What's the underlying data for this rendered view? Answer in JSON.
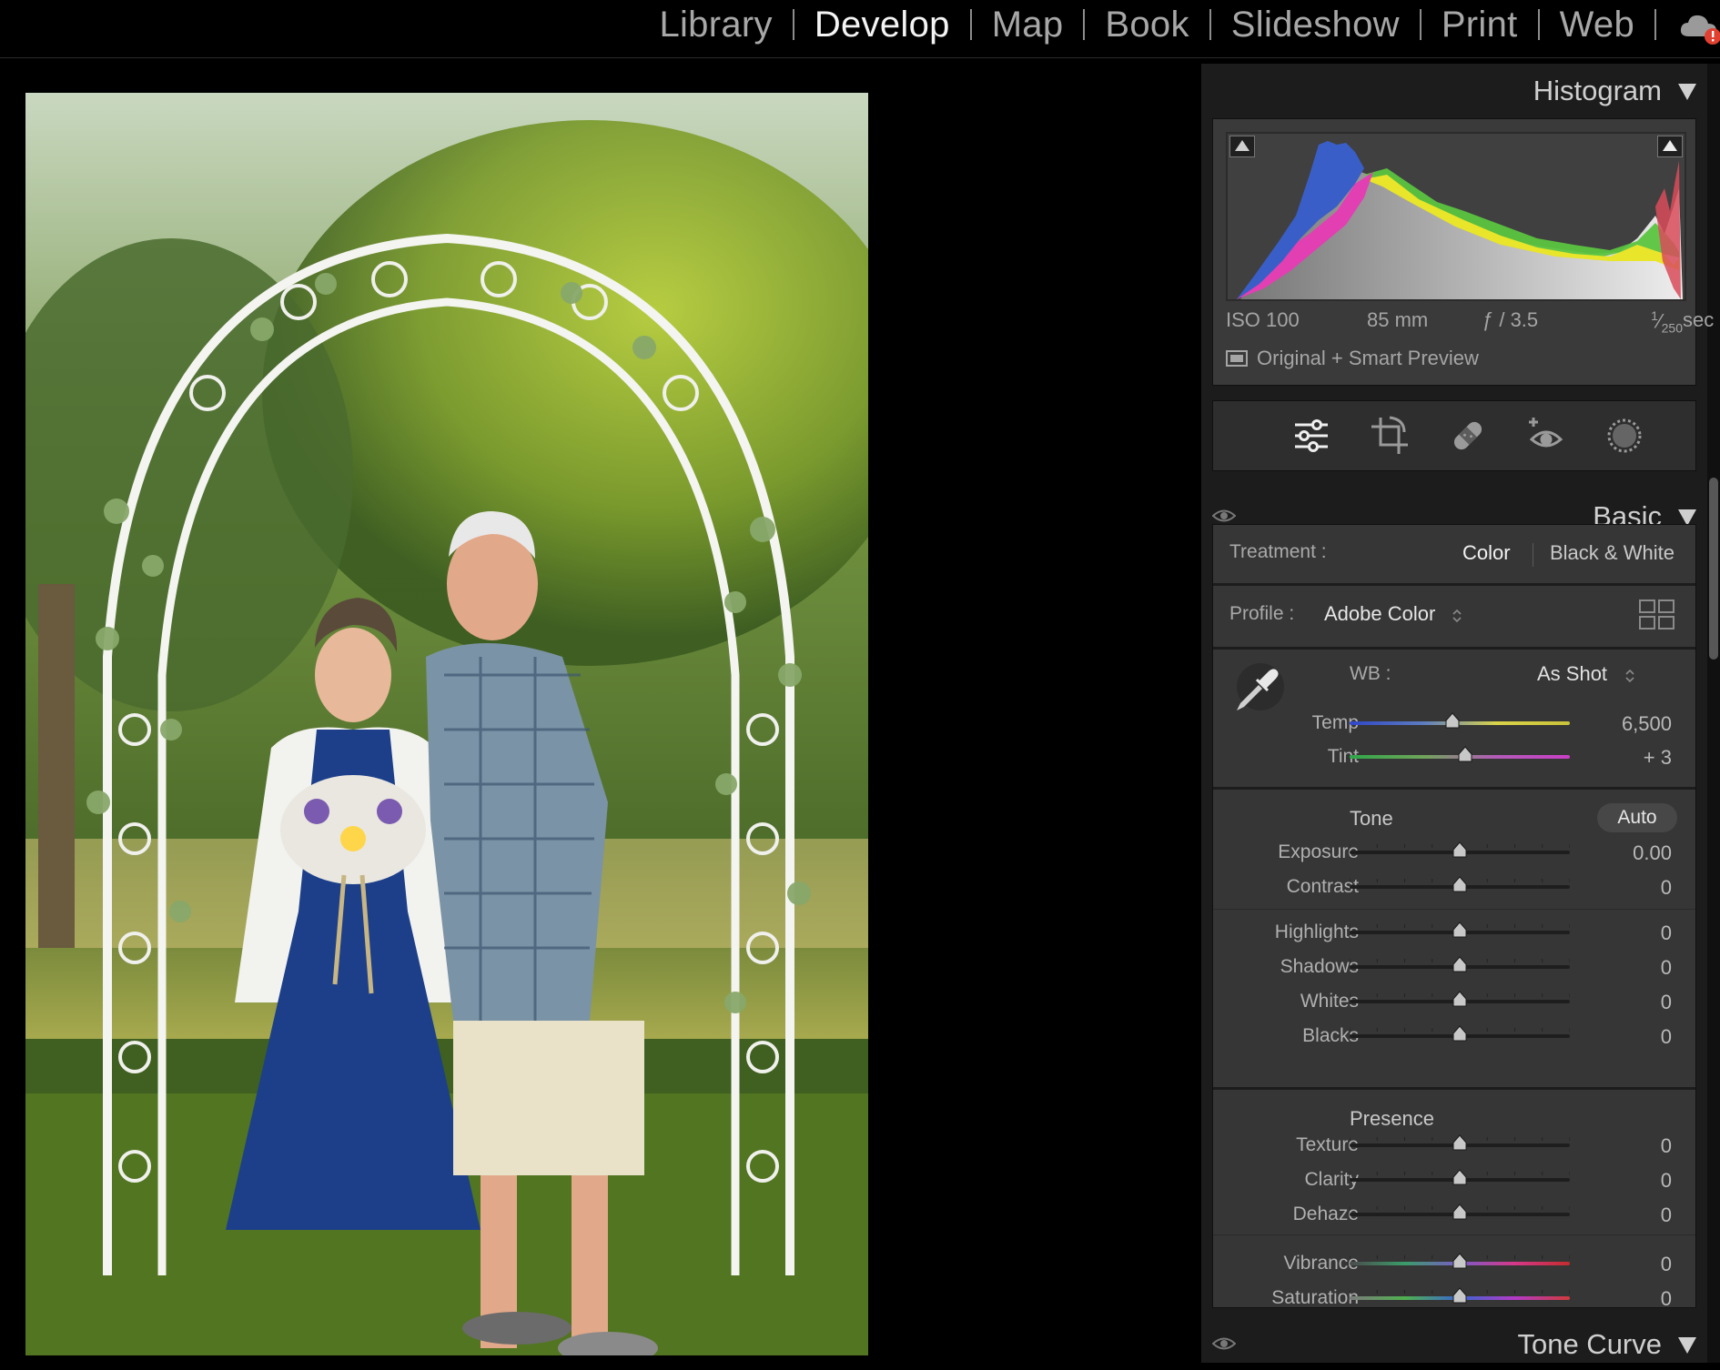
{
  "top_bar": {
    "modules": [
      {
        "label": "Library",
        "active": false
      },
      {
        "label": "Develop",
        "active": true
      },
      {
        "label": "Map",
        "active": false
      },
      {
        "label": "Book",
        "active": false
      },
      {
        "label": "Slideshow",
        "active": false
      },
      {
        "label": "Print",
        "active": false
      },
      {
        "label": "Web",
        "active": false
      }
    ],
    "cloud_icon": "cloud-alert-icon"
  },
  "photo": {
    "subject": "couple-under-arch"
  },
  "histogram": {
    "title": "Histogram",
    "iso": "ISO 100",
    "focal": "85 mm",
    "aperture": "ƒ / 3.5",
    "shutter_num": "1",
    "shutter_den": "250",
    "shutter_unit": "sec",
    "preview": "Original + Smart Preview"
  },
  "tools": [
    "sliders-icon",
    "crop-icon",
    "healing-icon",
    "red-eye-icon",
    "masking-icon"
  ],
  "basic": {
    "title": "Basic",
    "treatment_label": "Treatment :",
    "treatment_color": "Color",
    "treatment_bw": "Black & White",
    "profile_label": "Profile :",
    "profile_value": "Adobe Color",
    "wb_label": "WB :",
    "wb_value": "As Shot",
    "temp": {
      "label": "Temp",
      "value": "6,500"
    },
    "tint": {
      "label": "Tint",
      "value": "+ 3"
    },
    "tone_label": "Tone",
    "auto_label": "Auto",
    "tone": [
      {
        "label": "Exposure",
        "value": "0.00"
      },
      {
        "label": "Contrast",
        "value": "0"
      }
    ],
    "tone2": [
      {
        "label": "Highlights",
        "value": "0"
      },
      {
        "label": "Shadows",
        "value": "0"
      },
      {
        "label": "Whites",
        "value": "0"
      },
      {
        "label": "Blacks",
        "value": "0"
      }
    ],
    "presence_label": "Presence",
    "presence": [
      {
        "label": "Texture",
        "value": "0"
      },
      {
        "label": "Clarity",
        "value": "0"
      },
      {
        "label": "Dehaze",
        "value": "0"
      }
    ],
    "presence2": [
      {
        "label": "Vibrance",
        "value": "0"
      },
      {
        "label": "Saturation",
        "value": "0"
      }
    ]
  },
  "tone_curve": {
    "title": "Tone Curve"
  },
  "colors": {
    "accent": "#f4f4f4",
    "panel": "#363636",
    "cloud_alert": "#e04030"
  }
}
